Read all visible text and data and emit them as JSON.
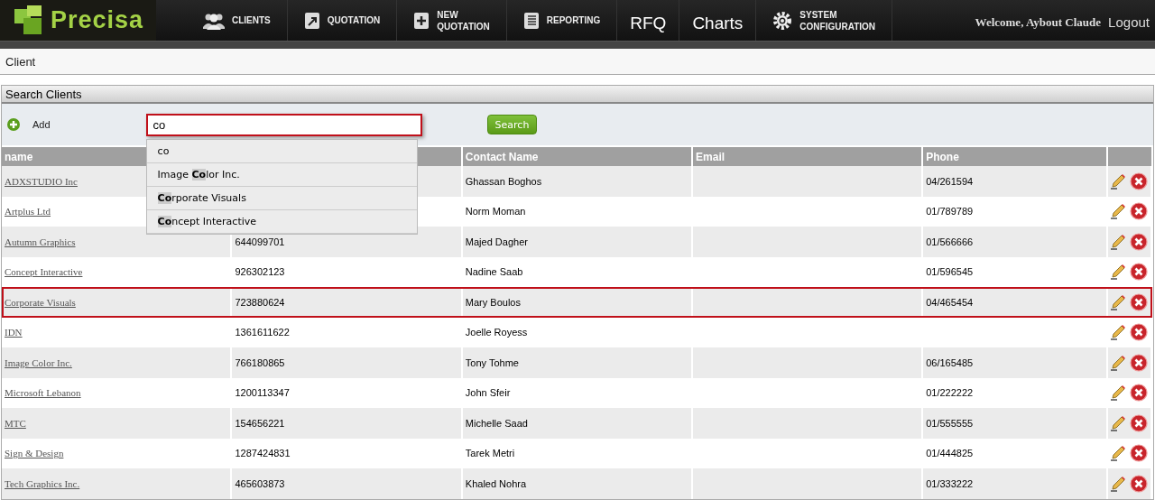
{
  "nav": {
    "logo": "Precisa",
    "items": [
      {
        "kind": "icon",
        "label": [
          "CLIENTS"
        ]
      },
      {
        "kind": "icon",
        "label": [
          "QUOTATION"
        ]
      },
      {
        "kind": "icon",
        "label": [
          "NEW",
          "QUOTATION"
        ]
      },
      {
        "kind": "icon",
        "label": [
          "REPORTING"
        ]
      },
      {
        "kind": "text",
        "label": [
          "RFQ"
        ]
      },
      {
        "kind": "text",
        "label": [
          "Charts"
        ]
      },
      {
        "kind": "icon",
        "label": [
          "SYSTEM",
          "CONFIGURATION"
        ]
      }
    ],
    "welcome": "Welcome, Aybout Claude",
    "logout": "Logout"
  },
  "breadcrumb": "Client",
  "panel": {
    "title": "Search Clients",
    "add": "Add",
    "search": {
      "value": "co",
      "button": "Search"
    },
    "suggestions": [
      "co",
      "Image **Co**lor Inc.",
      "**Co**rporate Visuals",
      "**Co**ncept Interactive"
    ]
  },
  "table": {
    "columns": [
      "name",
      "Contact Name",
      "Email",
      "Phone"
    ],
    "rows": [
      {
        "name": "ADXSTUDIO Inc",
        "contact": "Ghassan Boghos",
        "phone": "04/261594",
        "selected": false
      },
      {
        "name": "Artplus Ltd",
        "contact": "Norm Moman",
        "phone": "01/789789",
        "selected": false
      },
      {
        "name": "Autumn Graphics",
        "column_2": "644099701",
        "contact": "Majed Dagher",
        "phone": "01/566666",
        "selected": false
      },
      {
        "name": "Concept Interactive",
        "column_2": "926302123",
        "contact": "Nadine Saab",
        "phone": "01/596545",
        "selected": false
      },
      {
        "name": "Corporate Visuals",
        "column_2": "723880624",
        "contact": "Mary Boulos",
        "phone": "04/465454",
        "selected": true
      },
      {
        "name": "IDN",
        "column_2": "1361611622",
        "contact": "Joelle Royess",
        "selected": false
      },
      {
        "name": "Image Color Inc.",
        "column_2": "766180865",
        "contact": "Tony Tohme",
        "phone": "06/165485",
        "selected": false
      },
      {
        "name": "Microsoft Lebanon",
        "column_2": "1200113347",
        "contact": "John Sfeir",
        "phone": "01/222222",
        "selected": false
      },
      {
        "name": "MTC",
        "column_2": "154656221",
        "contact": "Michelle Saad",
        "phone": "01/555555",
        "selected": false
      },
      {
        "name": "Sign & Design",
        "column_2": "1287424831",
        "contact": "Tarek Metri",
        "phone": "01/444825",
        "selected": false
      },
      {
        "name": "Tech Graphics Inc.",
        "column_2": "465603873",
        "contact": "Khaled Nohra",
        "phone": "01/333222",
        "selected": false
      }
    ]
  }
}
